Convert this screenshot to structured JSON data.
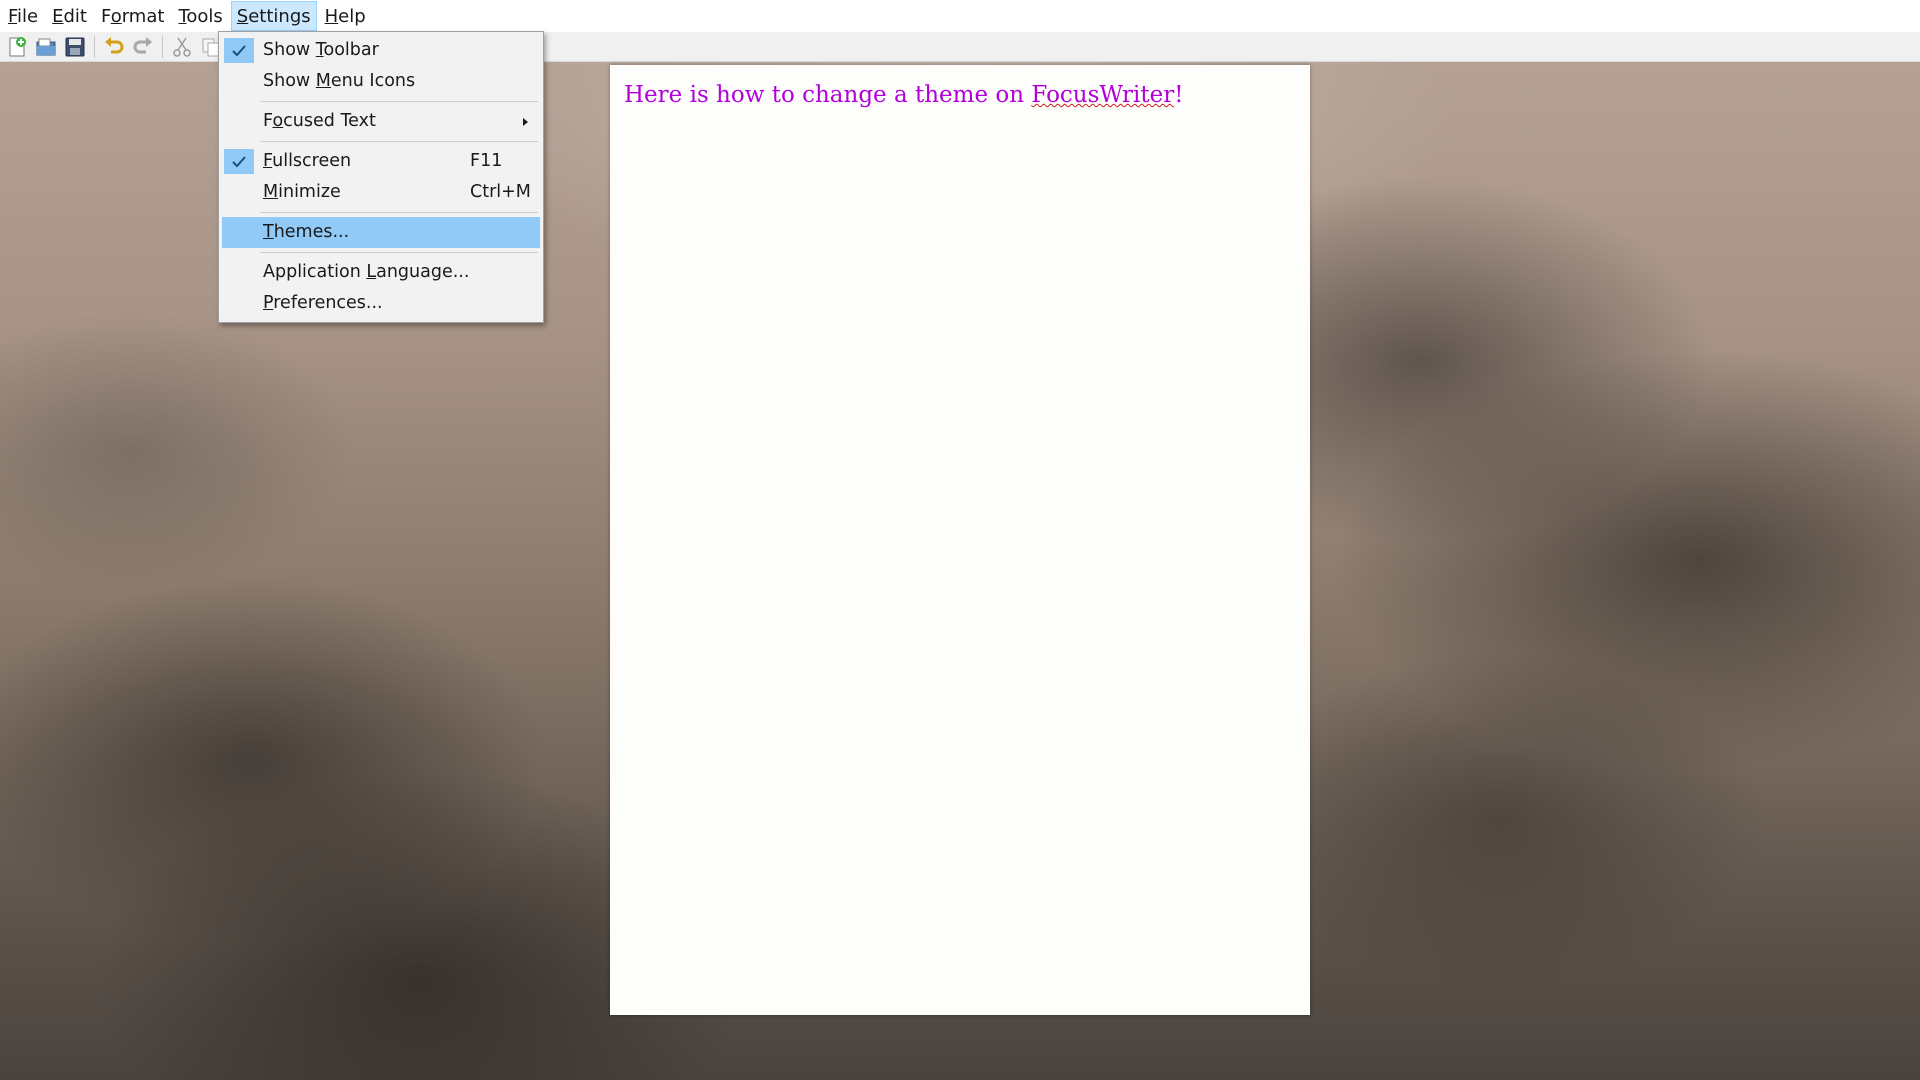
{
  "menubar": {
    "items": [
      {
        "pre": "",
        "ul": "F",
        "post": "ile"
      },
      {
        "pre": "",
        "ul": "E",
        "post": "dit"
      },
      {
        "pre": "F",
        "ul": "o",
        "post": "rmat"
      },
      {
        "pre": "",
        "ul": "T",
        "post": "ools"
      },
      {
        "pre": "",
        "ul": "S",
        "post": "ettings"
      },
      {
        "pre": "",
        "ul": "H",
        "post": "elp"
      }
    ],
    "active": "Settings"
  },
  "toolbar": {
    "buttons": [
      "new-document-icon",
      "open-icon",
      "save-icon",
      "undo-icon",
      "redo-icon",
      "cut-icon",
      "copy-icon"
    ]
  },
  "settings_menu": {
    "show_toolbar": {
      "pre": "Show ",
      "ul": "T",
      "post": "oolbar",
      "checked": true
    },
    "show_menu_icons": {
      "pre": "Show ",
      "ul": "M",
      "post": "enu Icons",
      "checked": false
    },
    "focused_text": {
      "pre": "F",
      "ul": "o",
      "post": "cused Text",
      "submenu": true
    },
    "fullscreen": {
      "pre": "",
      "ul": "F",
      "post": "ullscreen",
      "shortcut": "F11",
      "checked": true
    },
    "minimize": {
      "pre": "",
      "ul": "M",
      "post": "inimize",
      "shortcut": "Ctrl+M"
    },
    "themes": {
      "pre": "",
      "ul": "T",
      "post": "hemes...",
      "highlighted": true
    },
    "application_language": {
      "pre": "Application ",
      "ul": "L",
      "post": "anguage..."
    },
    "preferences": {
      "pre": "",
      "ul": "P",
      "post": "references..."
    }
  },
  "document": {
    "text_before": "Here is how to change a theme on ",
    "misspelled_word": "FocusWriter",
    "text_after": "!",
    "text_color": "#b200d9"
  },
  "colors": {
    "menu_highlight": "#91c9f7",
    "menubar_active": "#cce8ff"
  }
}
